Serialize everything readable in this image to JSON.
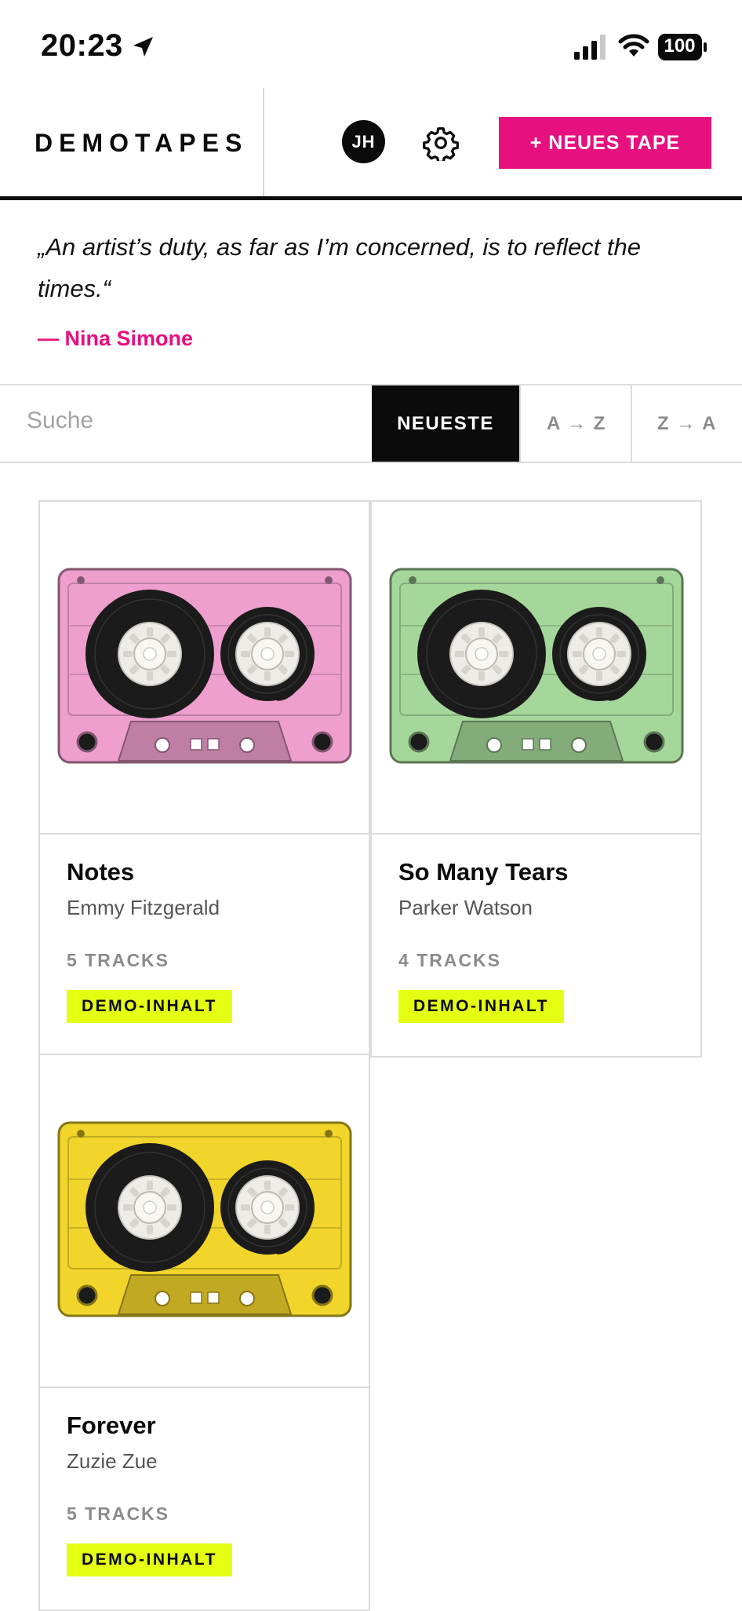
{
  "status_bar": {
    "time": "20:23",
    "battery": "100"
  },
  "header": {
    "brand": "DEMOTAPES",
    "avatar_initials": "JH",
    "new_tape_label": "+ NEUES TAPE"
  },
  "quote": {
    "text": "„An artist’s duty, as far as I’m concerned, is to reflect the times.“",
    "author": "— Nina Simone"
  },
  "toolbar": {
    "search_placeholder": "Suche",
    "sort_options": [
      "NEUESTE",
      "A → Z",
      "Z → A"
    ],
    "active_sort": "NEUESTE"
  },
  "tapes": [
    {
      "title": "Notes",
      "artist": "Emmy Fitzgerald",
      "tracks": "5 TRACKS",
      "badge": "DEMO-INHALT",
      "color": "#ef9fce"
    },
    {
      "title": "So Many Tears",
      "artist": "Parker Watson",
      "tracks": "4 TRACKS",
      "badge": "DEMO-INHALT",
      "color": "#a5d79a"
    },
    {
      "title": "Forever",
      "artist": "Zuzie Zue",
      "tracks": "5 TRACKS",
      "badge": "DEMO-INHALT",
      "color": "#f1d52a"
    }
  ],
  "colors": {
    "accent": "#e6107e",
    "badge": "#e4ff12",
    "ink": "#0b0b0b"
  }
}
